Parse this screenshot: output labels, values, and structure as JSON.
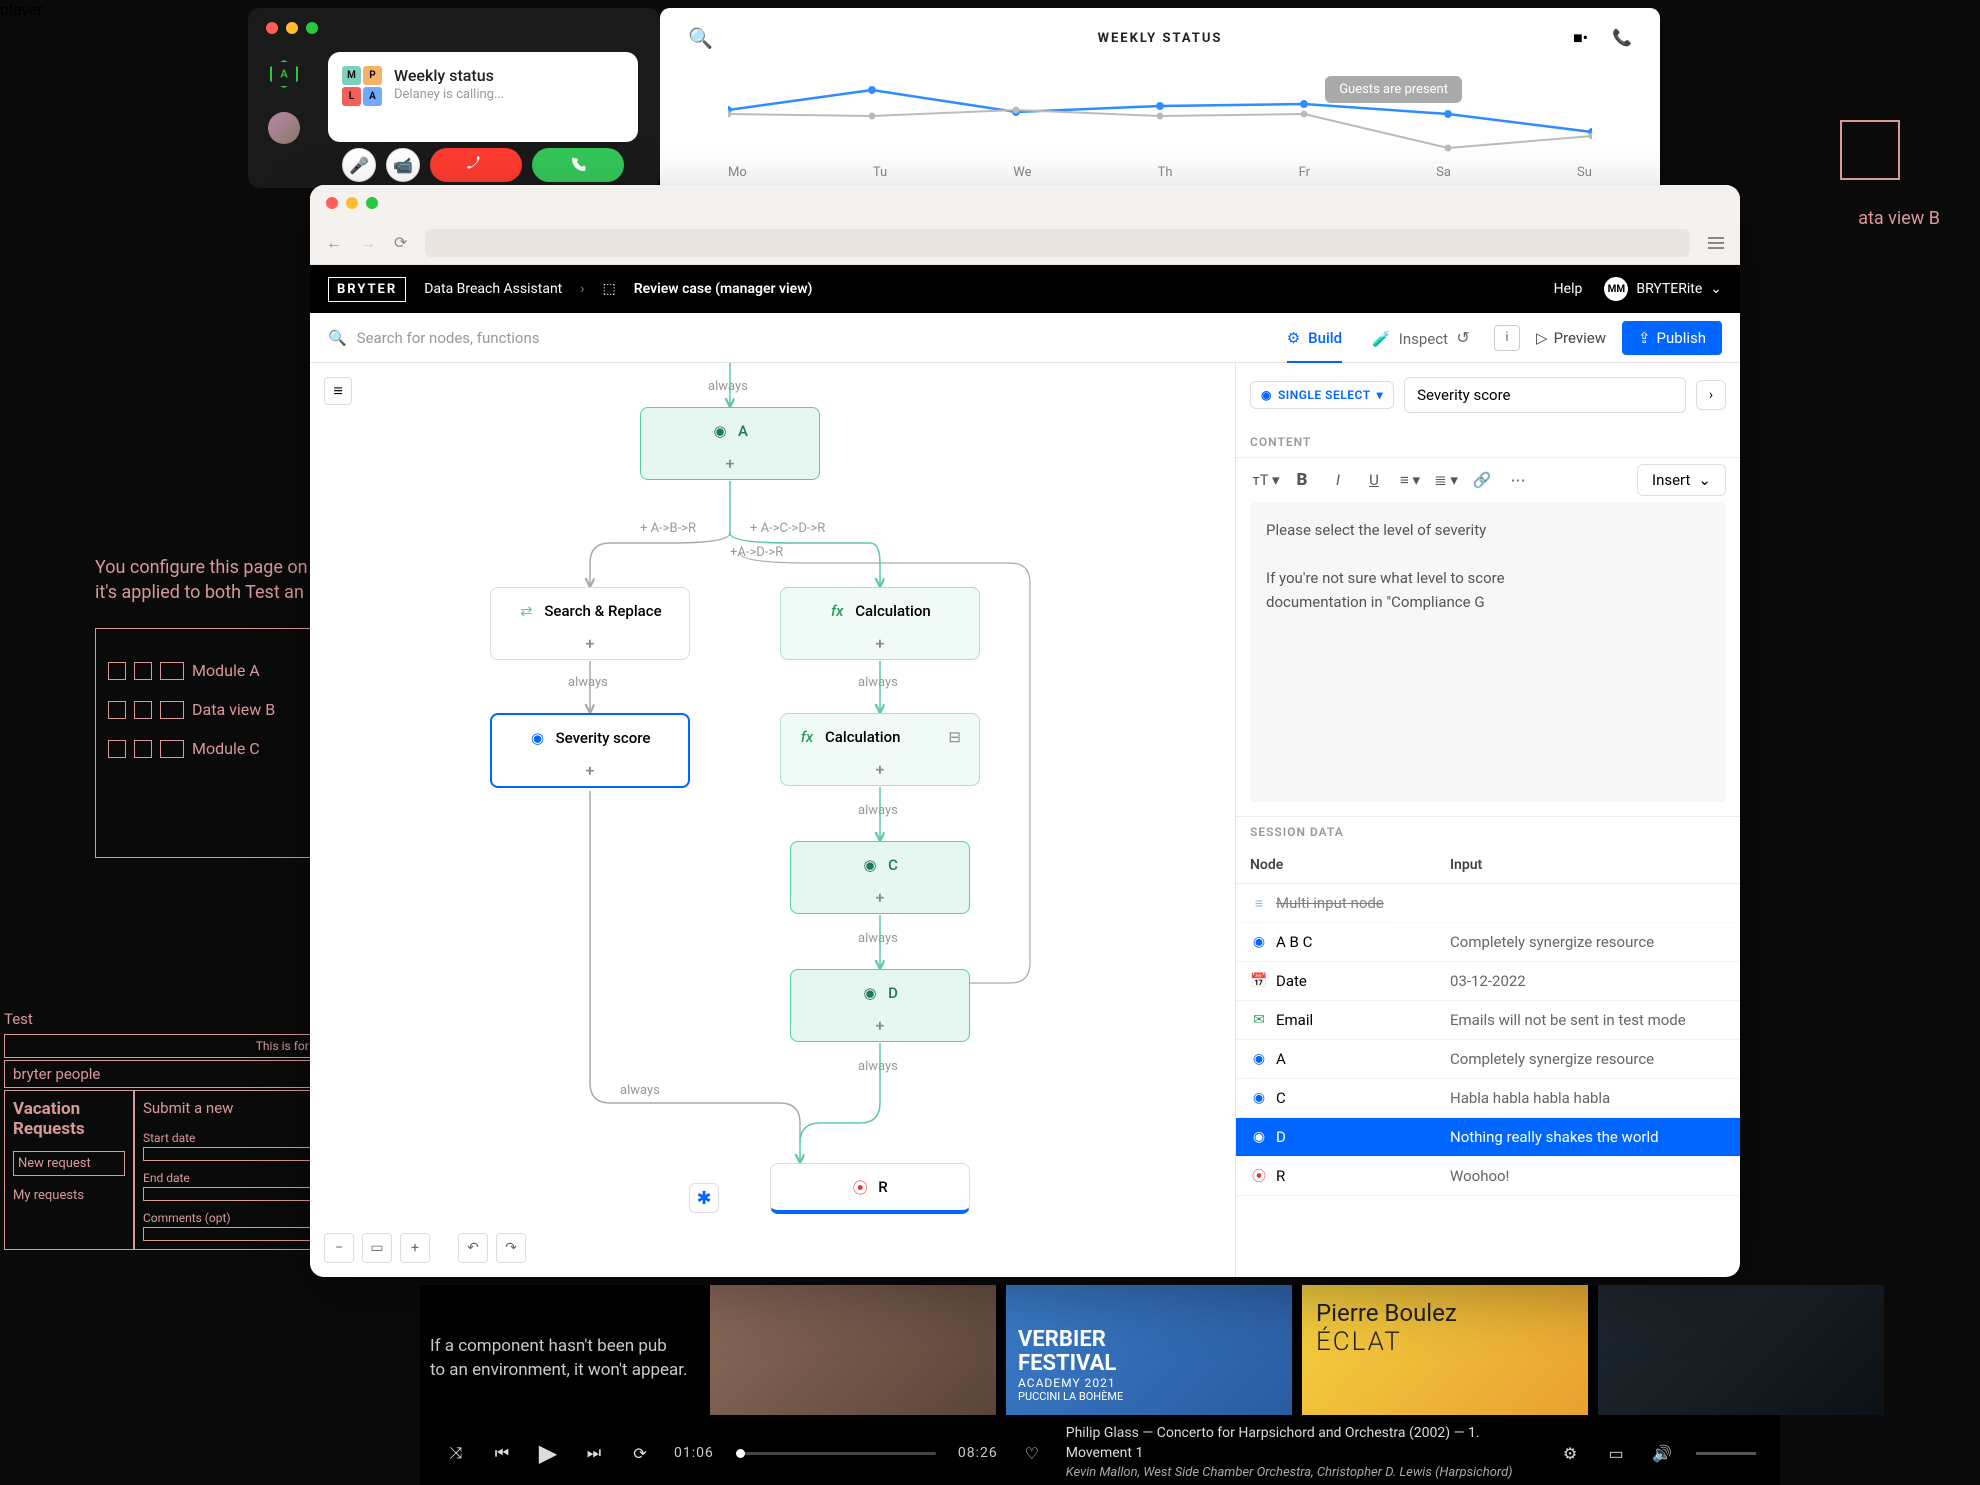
{
  "call": {
    "title": "Weekly status",
    "subtitle": "Delaney is calling...",
    "colors": [
      "M",
      "P",
      "L",
      "A"
    ]
  },
  "chart": {
    "title": "WEEKLY STATUS",
    "badge": "Guests are present",
    "axis": [
      "Mo",
      "Tu",
      "We",
      "Th",
      "Fr",
      "Sa",
      "Su"
    ]
  },
  "chart_data": {
    "type": "line",
    "categories": [
      "Mo",
      "Tu",
      "We",
      "Th",
      "Fr",
      "Sa",
      "Su"
    ],
    "series": [
      {
        "name": "blue",
        "values": [
          62,
          80,
          60,
          66,
          68,
          58,
          40
        ]
      },
      {
        "name": "gray",
        "values": [
          58,
          56,
          62,
          56,
          58,
          22,
          36
        ]
      }
    ],
    "ylim": [
      0,
      100
    ],
    "annotation": {
      "text": "Guests are present",
      "x": "Fr"
    }
  },
  "bryter": {
    "logo": "BRYTER",
    "breadcrumb1": "Data Breach Assistant",
    "breadcrumb2": "Review case (manager view)",
    "help": "Help",
    "user_initials": "MM",
    "user_name": "BRYTERite",
    "search_placeholder": "Search for nodes, functions",
    "tab_build": "Build",
    "tab_inspect": "Inspect",
    "preview": "Preview",
    "publish": "Publish",
    "nodes": {
      "a": "A",
      "search_replace": "Search & Replace",
      "calculation": "Calculation",
      "severity": "Severity score",
      "c": "C",
      "d": "D",
      "r": "R"
    },
    "edges": {
      "always": "always",
      "abr": "+ A->B->R",
      "acdr": "+ A->C->D->R",
      "adr": "+A->D->R"
    },
    "panel": {
      "type_label": "SINGLE SELECT",
      "title_value": "Severity score",
      "content_label": "CONTENT",
      "insert": "Insert",
      "body_line1": "Please select the level of severity",
      "body_line2": "If you're not sure what level to score",
      "body_line3": "documentation in \"Compliance G",
      "session_label": "SESSION DATA",
      "col_node": "Node",
      "col_input": "Input",
      "rows": [
        {
          "icon": "list",
          "name": "Multi input node",
          "value": ""
        },
        {
          "icon": "radio",
          "name": "A B C",
          "value": "Completely synergize resource"
        },
        {
          "icon": "calendar",
          "name": "Date",
          "value": "03-12-2022"
        },
        {
          "icon": "mail",
          "name": "Email",
          "value": "Emails will not be sent in test mode"
        },
        {
          "icon": "radio",
          "name": "A",
          "value": "Completely synergize resource"
        },
        {
          "icon": "radio",
          "name": "C",
          "value": "Habla habla habla habla"
        },
        {
          "icon": "radio",
          "name": "D",
          "value": "Nothing really shakes the world"
        },
        {
          "icon": "pin",
          "name": "R",
          "value": "Woohoo!"
        }
      ]
    }
  },
  "pink": {
    "config_line1": "You configure this page on",
    "config_line2": "it's applied to both Test an",
    "modules": [
      "Module A",
      "Data view B",
      "Module C"
    ],
    "data_view_b": "ata view B",
    "test": "Test",
    "testing": "This is for testing purpose",
    "bryter_people": "bryter people",
    "vacation": "Vacation Requests",
    "submit": "Submit a new",
    "new_request": "New request",
    "my_requests": "My requests",
    "start_date": "Start date",
    "end_date": "End date",
    "comments": "Comments (opt)",
    "component_hint1": "If a component hasn't been pub",
    "component_hint2": "to an environment, it won't appear."
  },
  "music": {
    "tiles": {
      "verbier_l1": "VERBIER",
      "verbier_l2": "FESTIVAL",
      "verbier_l3": "ACADEMY 2021",
      "verbier_l4": "PUCCINI LA BOHÈME",
      "boulez_l1": "Pierre Boulez",
      "boulez_l2": "ÉCLAT"
    },
    "time_cur": "01:06",
    "time_total": "08:26",
    "track_title": "Philip Glass — Concerto for Harpsichord and Orchestra (2002) — 1. Movement 1",
    "track_sub": "Kevin Mallon, West Side Chamber Orchestra, Christopher D. Lewis (Harpsichord)"
  }
}
